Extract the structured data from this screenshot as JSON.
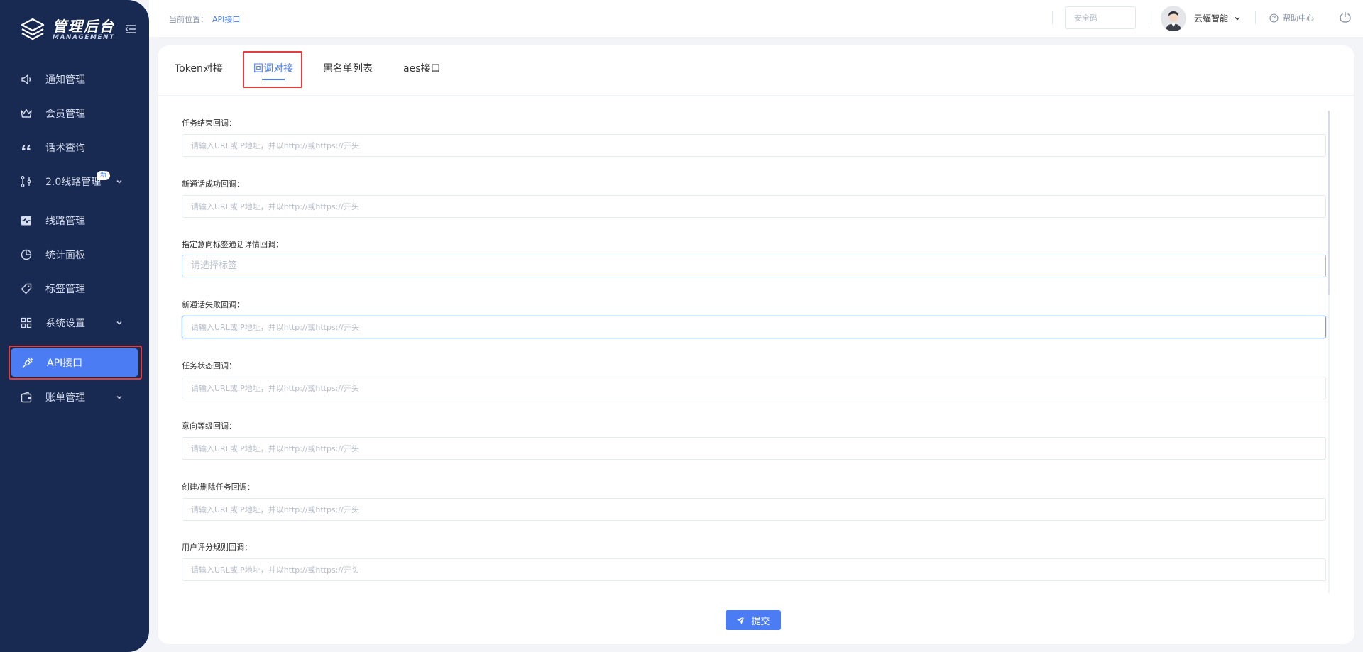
{
  "logo": {
    "title": "管理后台",
    "subtitle": "MANAGEMENT"
  },
  "sidebar": {
    "items": [
      {
        "label": "通知管理",
        "icon": "speaker-icon"
      },
      {
        "label": "会员管理",
        "icon": "crown-icon"
      },
      {
        "label": "话术查询",
        "icon": "quote-icon"
      },
      {
        "label": "2.0线路管理",
        "icon": "route-icon",
        "badge": "新"
      },
      {
        "label": "线路管理",
        "icon": "pulse-monitor-icon"
      },
      {
        "label": "统计面板",
        "icon": "pie-chart-icon"
      },
      {
        "label": "标签管理",
        "icon": "tag-icon"
      },
      {
        "label": "系统设置",
        "icon": "grid-icon"
      },
      {
        "label": "API接口",
        "icon": "plug-icon"
      },
      {
        "label": "账单管理",
        "icon": "wallet-icon"
      }
    ]
  },
  "header": {
    "breadcrumb_prefix": "当前位置：",
    "breadcrumb_current": "API接口",
    "security_placeholder": "安全码",
    "username": "云蝠智能",
    "help": "帮助中心"
  },
  "tabs": [
    {
      "label": "Token对接"
    },
    {
      "label": "回调对接"
    },
    {
      "label": "黑名单列表"
    },
    {
      "label": "aes接口"
    }
  ],
  "form": {
    "url_placeholder": "请输入URL或IP地址，并以http://或https://开头",
    "fields": [
      {
        "label": "任务结束回调："
      },
      {
        "label": "新通话成功回调："
      },
      {
        "label": "指定意向标签通话详情回调：",
        "select_placeholder": "请选择标签"
      },
      {
        "label": "新通话失败回调："
      },
      {
        "label": "任务状态回调："
      },
      {
        "label": "意向等级回调："
      },
      {
        "label": "创建/删除任务回调："
      },
      {
        "label": "用户评分规则回调："
      }
    ],
    "submit": "提交"
  },
  "colors": {
    "sidebar_bg": "#182952",
    "accent": "#4c7cf3",
    "highlight_frame": "#e43d3d"
  }
}
